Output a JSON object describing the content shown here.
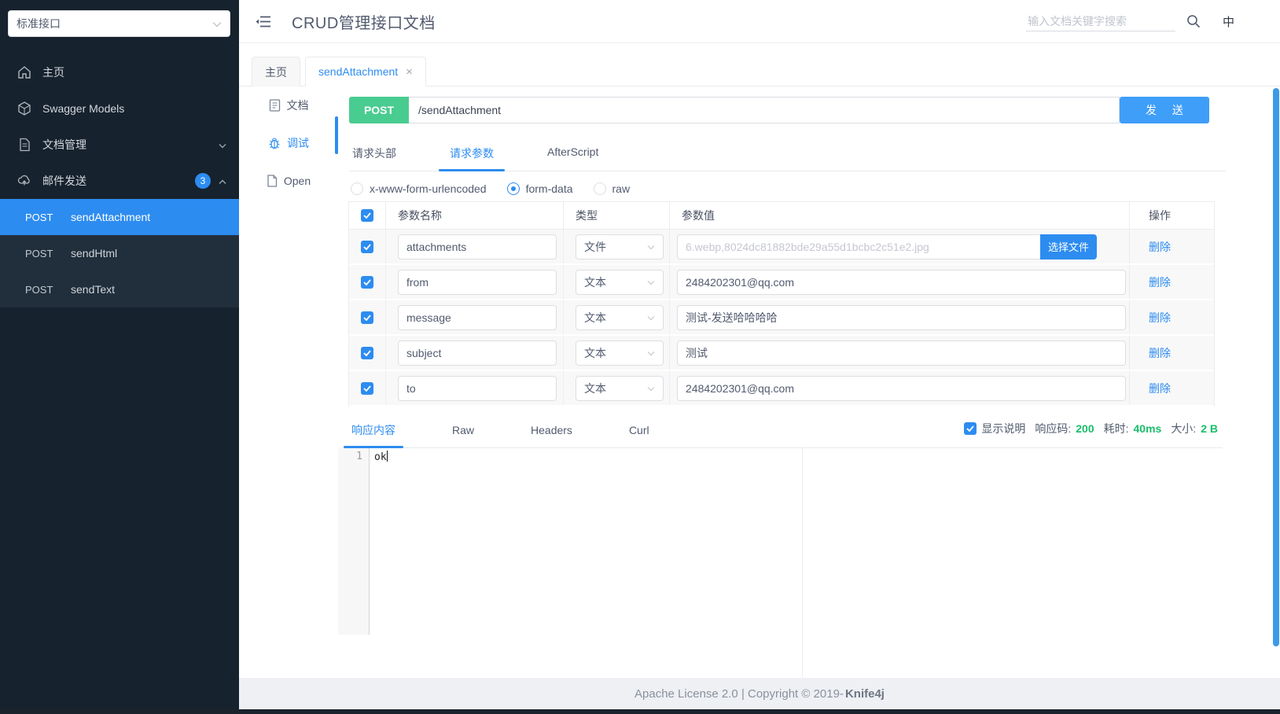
{
  "sidebar": {
    "group_select": "标准接口",
    "items": [
      {
        "label": "主页",
        "icon": "home-icon"
      },
      {
        "label": "Swagger Models",
        "icon": "models-icon"
      },
      {
        "label": "文档管理",
        "icon": "docs-icon",
        "chevron": "down"
      },
      {
        "label": "邮件发送",
        "icon": "mail-send-icon",
        "badge": "3",
        "chevron": "up"
      }
    ],
    "submenu": [
      {
        "method": "POST",
        "label": "sendAttachment",
        "active": true
      },
      {
        "method": "POST",
        "label": "sendHtml",
        "active": false
      },
      {
        "method": "POST",
        "label": "sendText",
        "active": false
      }
    ]
  },
  "header": {
    "title": "CRUD管理接口文档",
    "search_placeholder": "输入文档关键字搜索",
    "lang": "中"
  },
  "tabs": [
    {
      "label": "主页"
    },
    {
      "label": "sendAttachment",
      "close": "×"
    }
  ],
  "mini_sidebar": [
    {
      "label": "文档"
    },
    {
      "label": "调试"
    },
    {
      "label": "Open"
    }
  ],
  "request": {
    "method": "POST",
    "url": "/sendAttachment",
    "send_label": "发 送",
    "tabs": [
      "请求头部",
      "请求参数",
      "AfterScript"
    ],
    "body_modes": [
      "x-www-form-urlencoded",
      "form-data",
      "raw"
    ],
    "selected_mode": "form-data",
    "table": {
      "headers": {
        "name": "参数名称",
        "type": "类型",
        "value": "参数值",
        "action": "操作"
      },
      "file_button": "选择文件",
      "rows": [
        {
          "name": "attachments",
          "type": "文件",
          "value": "6.webp,8024dc81882bde29a55d1bcbc2c51e2.jpg",
          "action": "删除"
        },
        {
          "name": "from",
          "type": "文本",
          "value": "2484202301@qq.com",
          "action": "删除"
        },
        {
          "name": "message",
          "type": "文本",
          "value": "测试-发送哈哈哈哈",
          "action": "删除"
        },
        {
          "name": "subject",
          "type": "文本",
          "value": "测试",
          "action": "删除"
        },
        {
          "name": "to",
          "type": "文本",
          "value": "2484202301@qq.com",
          "action": "删除"
        }
      ]
    }
  },
  "response": {
    "tabs": [
      "响应内容",
      "Raw",
      "Headers",
      "Curl"
    ],
    "show_desc_label": "显示说明",
    "status_label": "响应码:",
    "status_value": "200",
    "time_label": "耗时:",
    "time_value": "40ms",
    "size_label": "大小:",
    "size_value": "2 B",
    "editor": {
      "line_number": "1",
      "content": "ok"
    }
  },
  "footer": {
    "text": "Apache License 2.0 | Copyright © 2019-",
    "brand": "Knife4j"
  },
  "colors": {
    "accent_blue": "#2d8cf0",
    "post_green": "#49cc90",
    "success_green": "#19be6b",
    "sidebar_dark": "#16222d"
  }
}
